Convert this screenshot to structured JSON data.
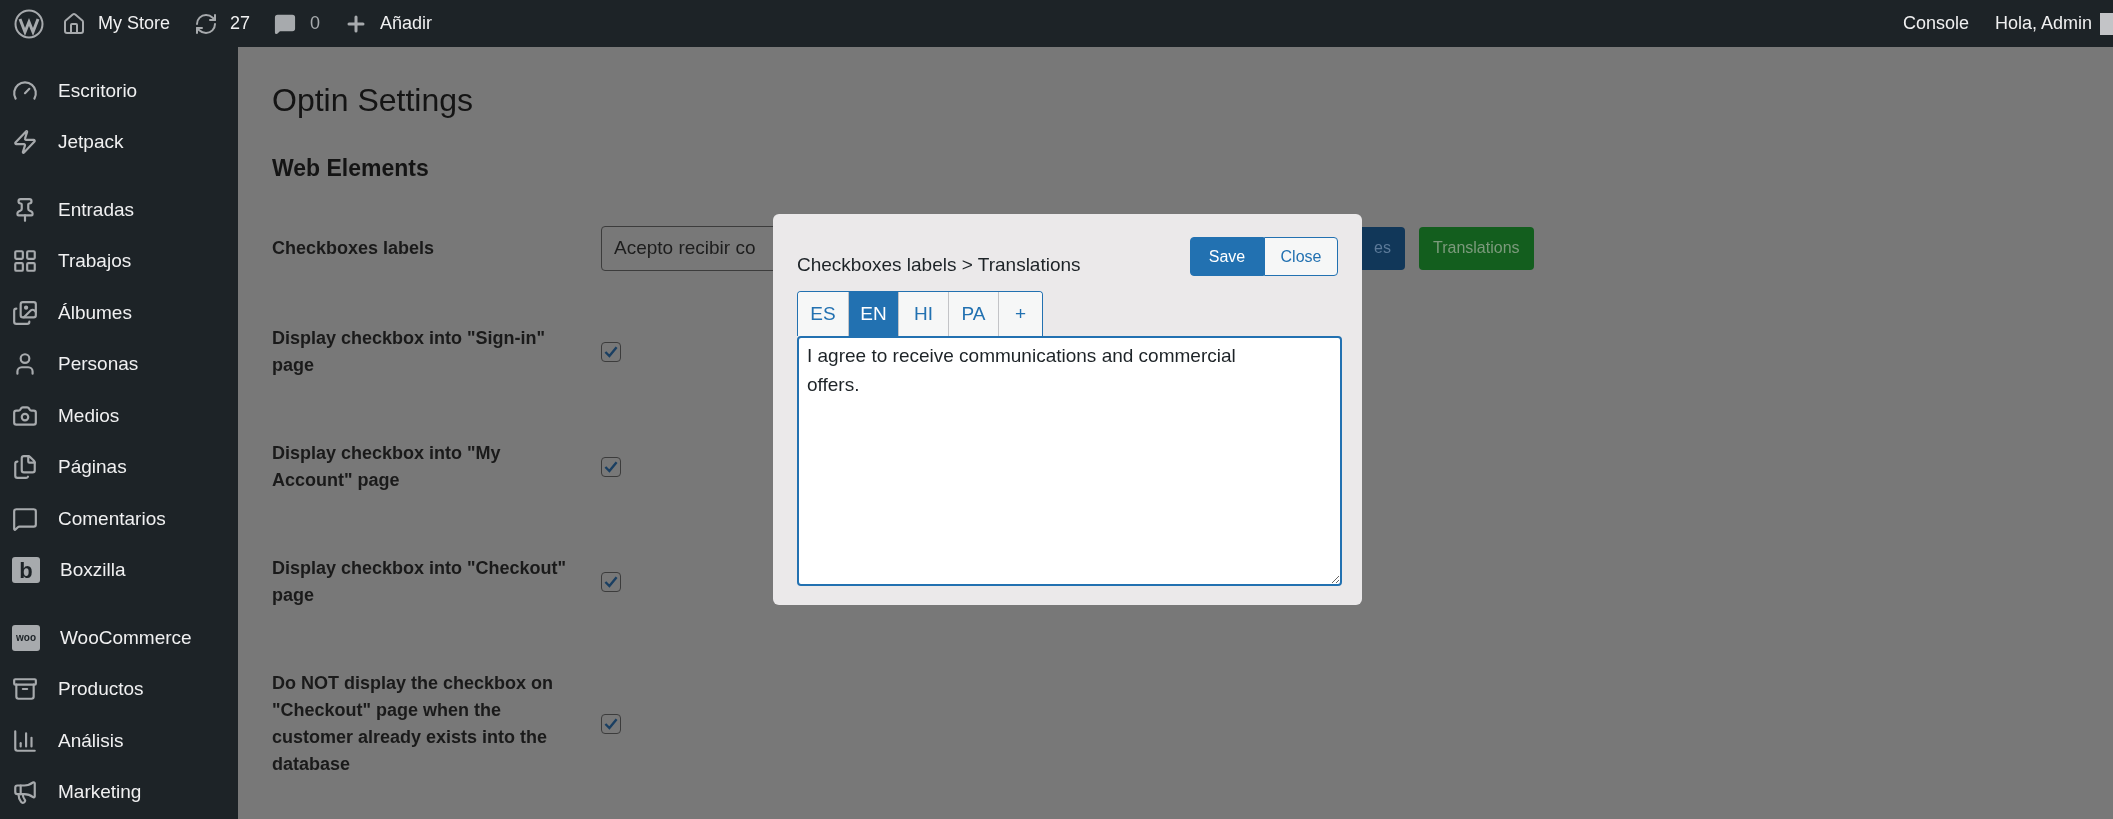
{
  "top_bar": {
    "site": "My Store",
    "updates": "27",
    "comments": "0",
    "new": "Añadir",
    "console": "Console",
    "greeting": "Hola, Admin"
  },
  "sidebar": {
    "groups": [
      {
        "items": [
          {
            "label": "Escritorio"
          },
          {
            "label": "Jetpack"
          }
        ]
      },
      {
        "items": [
          {
            "label": "Entradas"
          },
          {
            "label": "Trabajos"
          },
          {
            "label": "Álbumes"
          },
          {
            "label": "Personas"
          },
          {
            "label": "Medios"
          },
          {
            "label": "Páginas"
          },
          {
            "label": "Comentarios"
          },
          {
            "label": "Boxzilla",
            "icon_text": "b"
          }
        ]
      },
      {
        "items": [
          {
            "label": "WooCommerce",
            "icon_text": "woo"
          },
          {
            "label": "Productos"
          },
          {
            "label": "Análisis"
          },
          {
            "label": "Marketing"
          }
        ]
      }
    ]
  },
  "page": {
    "title": "Optin Settings",
    "section": "Web Elements",
    "rows": [
      {
        "kind": "text",
        "label": "Checkboxes labels",
        "value": "Acepto recibir co",
        "buttons": [
          {
            "label": "es",
            "kind": "primary"
          },
          {
            "label": "Translations",
            "kind": "success"
          }
        ]
      },
      {
        "kind": "checkbox",
        "label": "Display checkbox into \"Sign-in\" page",
        "checked": true
      },
      {
        "kind": "checkbox",
        "label": "Display checkbox into \"My Account\" page",
        "checked": true
      },
      {
        "kind": "checkbox",
        "label": "Display checkbox into \"Checkout\" page",
        "checked": true
      },
      {
        "kind": "checkbox",
        "label": "Do NOT display the checkbox on \"Checkout\" page when the customer already exists into the database",
        "checked": true
      }
    ]
  },
  "dialog": {
    "title": "Checkboxes labels > Translations",
    "save": "Save",
    "close": "Close",
    "tabs": [
      {
        "label": "ES",
        "selected": false
      },
      {
        "label": "EN",
        "selected": true
      },
      {
        "label": "HI",
        "selected": false
      },
      {
        "label": "PA",
        "selected": false
      },
      {
        "label": "+",
        "selected": false
      }
    ],
    "text": "I agree to receive communications and commercial offers."
  }
}
